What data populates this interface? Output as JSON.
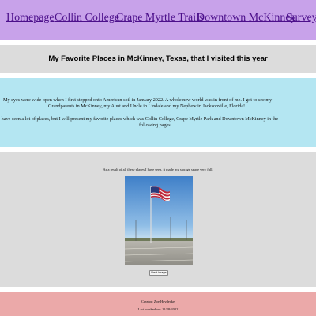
{
  "nav": {
    "links": [
      "Homepage",
      "Collin College",
      "Crape Myrtle Trails",
      "Downtown McKinney",
      "Survey"
    ]
  },
  "page_title": "My Favorite Places in McKinney, Texas, that I visited this year",
  "intro": {
    "paragraph_1_line_1": "My eyes were wide open when I first stepped onto American soil in January 2022. A whole new world was in front of me. I got to see my",
    "paragraph_1_line_2": "Grandparents in McKinney, my Aunt and Uncle in Lindale and my Nephew in Jacksonville, Florida!",
    "paragraph_2_line_1": "I have seen a lot of places, but I will present my favorite places which was Collin College, Crape Myrtle Park and Downtown McKinney in the",
    "paragraph_2_line_2": "following pages."
  },
  "gallery": {
    "caption": "As a result of all these places I have seen, it made my storage space very full.",
    "next_button": "Next image"
  },
  "footer": {
    "creator": "Creator: Zoe Heydecke",
    "last_worked": "Last worked on: 11/28/2022"
  },
  "colors": {
    "nav_bg": "#c8a2ea",
    "link": "#4b0f8a",
    "band_gray": "#dcdcdc",
    "intro_bg": "#b4e6f2",
    "footer_bg": "#eba9a9"
  }
}
